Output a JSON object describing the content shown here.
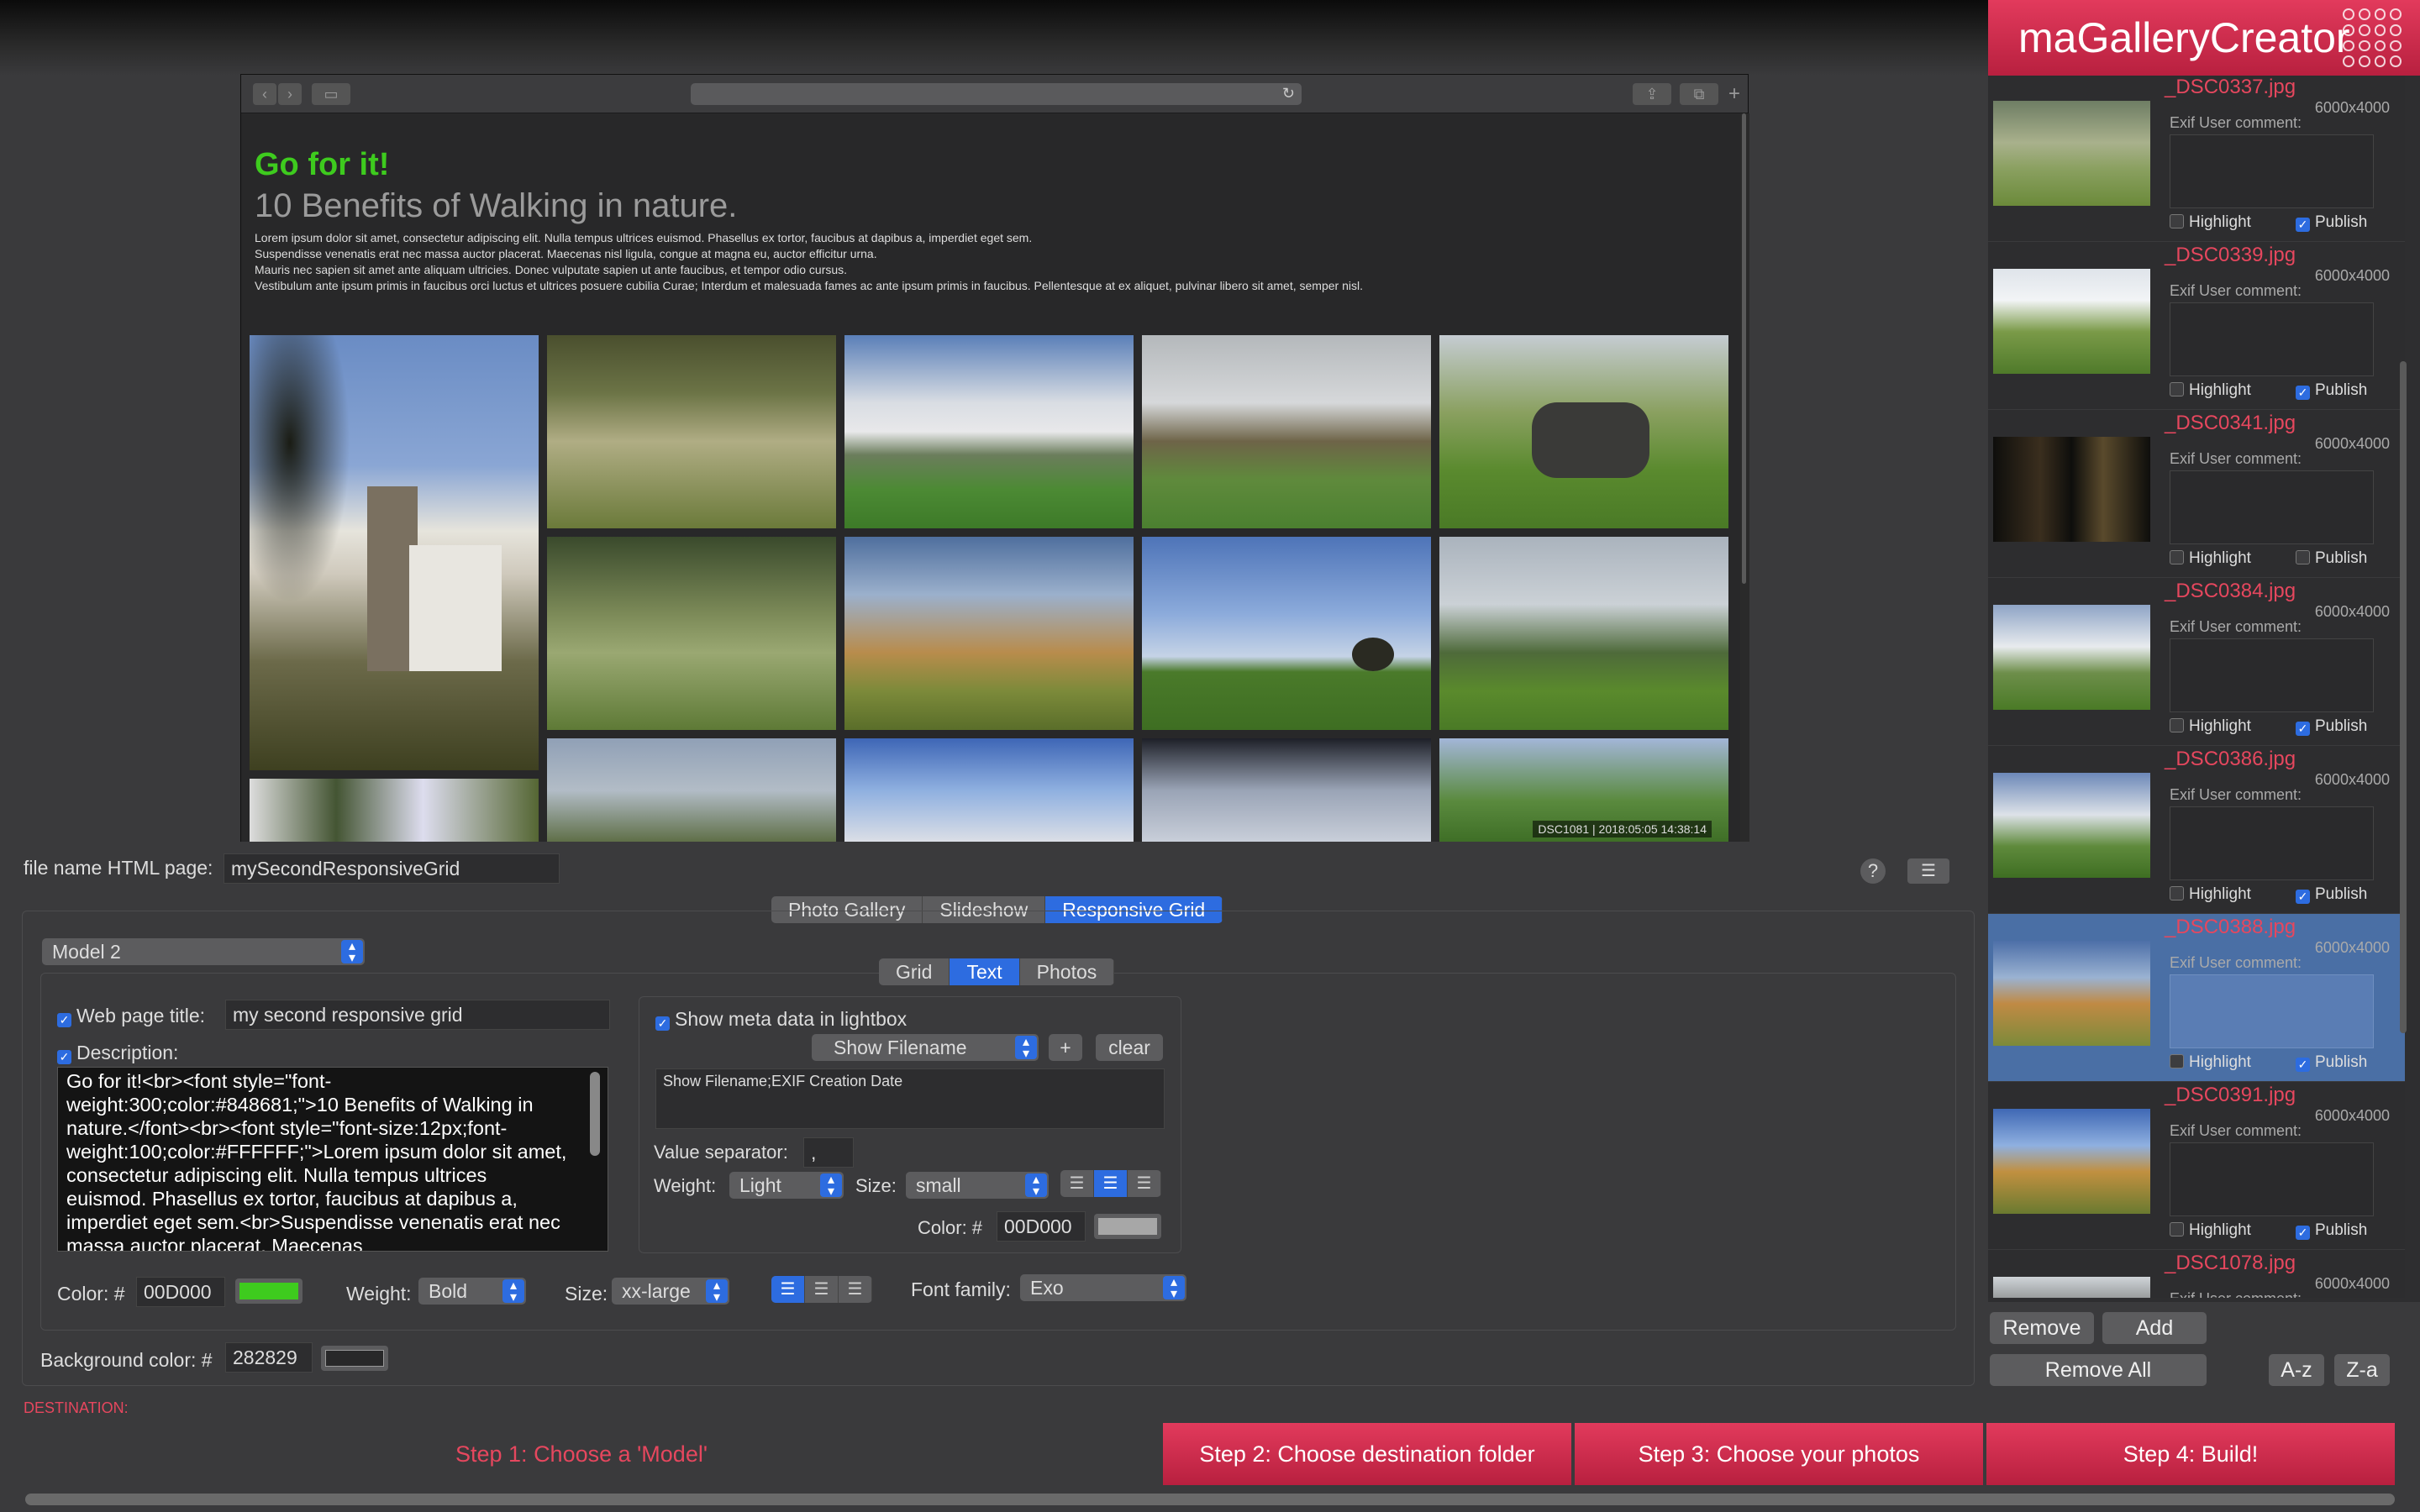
{
  "app": {
    "name": "maGalleryCreator"
  },
  "preview": {
    "heading": "Go for it!",
    "subheading": "10 Benefits of Walking in nature.",
    "lorem_lines": [
      "Lorem ipsum dolor sit amet, consectetur adipiscing elit. Nulla tempus ultrices euismod. Phasellus ex tortor, faucibus at dapibus a, imperdiet eget sem.",
      "Suspendisse venenatis erat nec massa auctor placerat. Maecenas nisl ligula, congue at magna eu, auctor efficitur urna.",
      "Mauris nec sapien sit amet ante aliquam ultricies. Donec vulputate sapien ut ante faucibus, et tempor odio cursus.",
      "Vestibulum ante ipsum primis in faucibus orci luctus et ultrices posuere cubilia Curae; Interdum et malesuada fames ac ante ipsum primis in faucibus. Pellentesque at ex aliquet, pulvinar libero sit amet, semper nisl."
    ],
    "caption": "DSC1081  |  2018:05:05 14:38:14"
  },
  "photos": [
    {
      "name": "_DSC0337.jpg",
      "dims": "6000x4000",
      "exif_label": "Exif User comment:",
      "highlight": false,
      "publish": true,
      "selected": false
    },
    {
      "name": "_DSC0339.jpg",
      "dims": "6000x4000",
      "exif_label": "Exif User comment:",
      "highlight": false,
      "publish": true,
      "selected": false
    },
    {
      "name": "_DSC0341.jpg",
      "dims": "6000x4000",
      "exif_label": "Exif User comment:",
      "highlight": false,
      "publish": false,
      "selected": false
    },
    {
      "name": "_DSC0384.jpg",
      "dims": "6000x4000",
      "exif_label": "Exif User comment:",
      "highlight": false,
      "publish": true,
      "selected": false
    },
    {
      "name": "_DSC0386.jpg",
      "dims": "6000x4000",
      "exif_label": "Exif User comment:",
      "highlight": false,
      "publish": true,
      "selected": false
    },
    {
      "name": "_DSC0388.jpg",
      "dims": "6000x4000",
      "exif_label": "Exif User comment:",
      "highlight": false,
      "publish": true,
      "selected": true
    },
    {
      "name": "_DSC0391.jpg",
      "dims": "6000x4000",
      "exif_label": "Exif User comment:",
      "highlight": false,
      "publish": true,
      "selected": false
    },
    {
      "name": "_DSC1078.jpg",
      "dims": "6000x4000",
      "exif_label": "Exif User comment:",
      "highlight": false,
      "publish": true,
      "selected": false
    }
  ],
  "photo_labels": {
    "highlight": "Highlight",
    "publish": "Publish"
  },
  "photo_buttons": {
    "remove": "Remove",
    "add": "Add",
    "remove_all": "Remove All",
    "sort_az": "A-z",
    "sort_za": "Z-a"
  },
  "settings": {
    "filename_label": "file name HTML page:",
    "filename_value": "mySecondResponsiveGrid",
    "mode_tabs": [
      "Photo Gallery",
      "Slideshow",
      "Responsive Grid"
    ],
    "active_mode": "Responsive Grid",
    "model_value": "Model 2",
    "sub_tabs": [
      "Grid",
      "Text",
      "Photos"
    ],
    "active_sub": "Text",
    "web_title_label": "Web page title:",
    "web_title_value": "my second responsive grid",
    "web_title_checked": true,
    "description_label": "Description:",
    "description_checked": true,
    "description_value": "Go for it!<br><font style=\"font-weight:300;color:#848681;\">10 Benefits of Walking in nature.</font><br><font style=\"font-size:12px;font-weight:100;color:#FFFFFF;\">Lorem ipsum dolor sit amet, consectetur adipiscing elit. Nulla tempus ultrices euismod. Phasellus ex tortor, faucibus at dapibus a, imperdiet eget sem.<br>Suspendisse venenatis erat nec massa auctor placerat. Maecenas",
    "text_color_label": "Color: #",
    "text_color_value": "00D000",
    "text_color_swatch": "#3ecb1e",
    "weight_label": "Weight:",
    "weight_value": "Bold",
    "size_label": "Size:",
    "size_value": "xx-large",
    "font_family_label": "Font family:",
    "font_family_value": "Exo",
    "bg_color_label": "Background color: #",
    "bg_color_value": "282829",
    "bg_color_swatch": "#282829",
    "destination_label": "DESTINATION:"
  },
  "meta": {
    "show_meta_label": "Show meta data in lightbox",
    "show_meta_checked": true,
    "field_select": "Show Filename",
    "plus_label": "+",
    "clear_label": "clear",
    "fields_text": "Show Filename;EXIF Creation Date",
    "separator_label": "Value separator:",
    "separator_value": ",",
    "weight_label": "Weight:",
    "weight_value": "Light",
    "size_label": "Size:",
    "size_value": "small",
    "color_label": "Color: #",
    "color_value": "00D000",
    "color_swatch": "#a7a7a7"
  },
  "steps": {
    "step1": "Step 1: Choose a 'Model'",
    "step2": "Step 2: Choose destination folder",
    "step3": "Step 3: Choose your photos",
    "step4": "Step 4: Build!"
  },
  "colors": {
    "accent": "#2d6ce0",
    "brand": "#d92e52",
    "step_active_text": "#e6475e",
    "green": "#3ecb1e"
  }
}
